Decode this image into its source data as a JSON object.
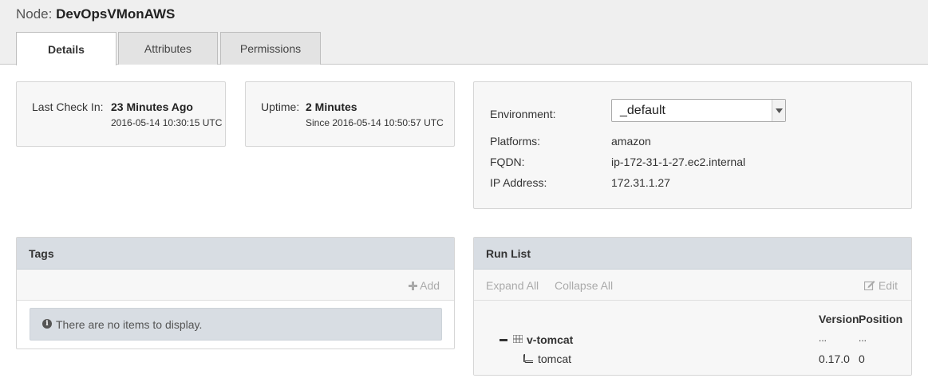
{
  "node": {
    "prefix": "Node:",
    "name": "DevOpsVMonAWS"
  },
  "tabs": [
    {
      "label": "Details",
      "active": true
    },
    {
      "label": "Attributes",
      "active": false
    },
    {
      "label": "Permissions",
      "active": false
    }
  ],
  "checkin": {
    "label": "Last Check In:",
    "value": "23 Minutes Ago",
    "timestamp": "2016-05-14 10:30:15 UTC"
  },
  "uptime": {
    "label": "Uptime:",
    "value": "2 Minutes",
    "since": "Since 2016-05-14 10:50:57 UTC"
  },
  "info": {
    "environment_label": "Environment:",
    "environment_value": "_default",
    "platforms_label": "Platforms:",
    "platforms_value": "amazon",
    "fqdn_label": "FQDN:",
    "fqdn_value": "ip-172-31-1-27.ec2.internal",
    "ip_label": "IP Address:",
    "ip_value": "172.31.1.27"
  },
  "tags": {
    "title": "Tags",
    "add_label": "Add",
    "empty_message": "There are no items to display."
  },
  "runlist": {
    "title": "Run List",
    "expand_all": "Expand All",
    "collapse_all": "Collapse All",
    "edit_label": "Edit",
    "col_version": "Version",
    "col_position": "Position",
    "role": {
      "name": "v-tomcat",
      "version": "...",
      "position": "..."
    },
    "recipe": {
      "name": "tomcat",
      "version": "0.17.0",
      "position": "0"
    }
  },
  "icons": {
    "info": "info-circle-icon",
    "add": "plus-icon",
    "edit": "edit-icon",
    "collapse": "minus-icon",
    "role": "role-grid-icon",
    "recipe": "book-icon",
    "select": "chevron-down-icon"
  }
}
